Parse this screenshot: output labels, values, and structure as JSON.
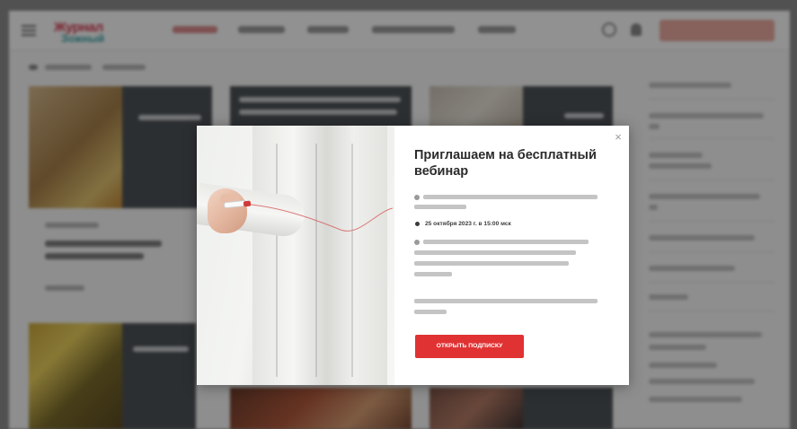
{
  "modal": {
    "title": "Приглашаем на бесплатный вебинар",
    "close_glyph": "×",
    "event_date": "25 октября 2023 г. в 15:00 мск",
    "cta_label": "ОТКРЫТЬ ПОДПИСКУ"
  },
  "header": {
    "logo_line_1": "Журнал",
    "logo_line_2": "Зожный"
  },
  "colors": {
    "accent_red": "#e03233",
    "overlay": "rgba(0,0,0,0.42)",
    "card_panel": "#4d5256"
  },
  "icons": [
    "menu-icon",
    "search-icon",
    "user-icon",
    "close-icon"
  ]
}
